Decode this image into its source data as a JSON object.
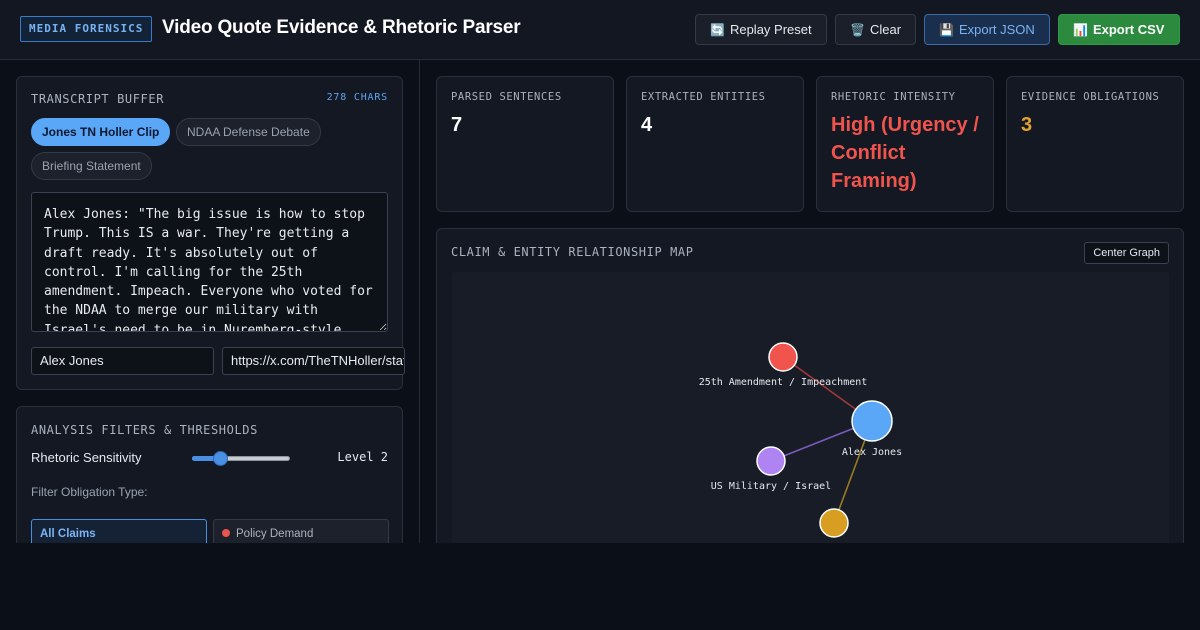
{
  "header": {
    "badge": "MEDIA FORENSICS",
    "title": "Video Quote Evidence & Rhetoric Parser",
    "buttons": {
      "replay": {
        "icon": "🔄",
        "label": "Replay Preset"
      },
      "clear": {
        "icon": "🗑️",
        "label": "Clear"
      },
      "export_json": {
        "icon": "💾",
        "label": "Export JSON"
      },
      "export_csv": {
        "icon": "📊",
        "label": "Export CSV"
      }
    }
  },
  "transcript": {
    "title": "TRANSCRIPT BUFFER",
    "char_count": "278 CHARS",
    "presets": [
      "Jones TN Holler Clip",
      "NDAA Defense Debate",
      "Briefing Statement"
    ],
    "active_preset": 0,
    "text": "Alex Jones: \"The big issue is how to stop Trump. This IS a war. They're getting a draft ready. It's absolutely out of control. I'm calling for the 25th amendment. Impeach. Everyone who voted for the NDAA to merge our military with Israel's need to be in Nuremberg-style",
    "speaker_value": "Alex Jones",
    "source_url_value": "https://x.com/TheTNHoller/status/"
  },
  "filters": {
    "title": "ANALYSIS FILTERS & THRESHOLDS",
    "sensitivity_label": "Rhetoric Sensitivity",
    "sensitivity_level": 2,
    "sensitivity_min": 1,
    "sensitivity_max": 5,
    "level_text": "Level 2",
    "obligation_label": "Filter Obligation Type:",
    "obligation_types": [
      {
        "label": "All Claims",
        "active": true
      },
      {
        "label": "Policy Demand",
        "color": "#e8554e"
      }
    ]
  },
  "stats": [
    {
      "label": "PARSED SENTENCES",
      "value": "7",
      "color": "#ffffff"
    },
    {
      "label": "EXTRACTED ENTITIES",
      "value": "4",
      "color": "#ffffff"
    },
    {
      "label": "RHETORIC INTENSITY",
      "value": "High (Urgency / Conflict Framing)",
      "color": "#f0544c"
    },
    {
      "label": "EVIDENCE OBLIGATIONS",
      "value": "3",
      "color": "#e0a332"
    }
  ],
  "graph": {
    "title": "CLAIM & ENTITY RELATIONSHIP MAP",
    "center_label": "Center Graph",
    "nodes": [
      {
        "id": "n1",
        "label": "25th Amendment / Impeachment",
        "color": "#f0544c"
      },
      {
        "id": "n0",
        "label": "Alex Jones",
        "color": "#5aa6f7"
      },
      {
        "id": "n2",
        "label": "US Military / Israel",
        "color": "#b083f3"
      },
      {
        "id": "n3",
        "label": "",
        "color": "#d89e22"
      }
    ],
    "edges": [
      {
        "from": "n0",
        "to": "n1",
        "color": "#a0383a"
      },
      {
        "from": "n0",
        "to": "n2",
        "color": "#7a5cb8"
      },
      {
        "from": "n0",
        "to": "n3",
        "color": "#9a7a22"
      }
    ]
  }
}
